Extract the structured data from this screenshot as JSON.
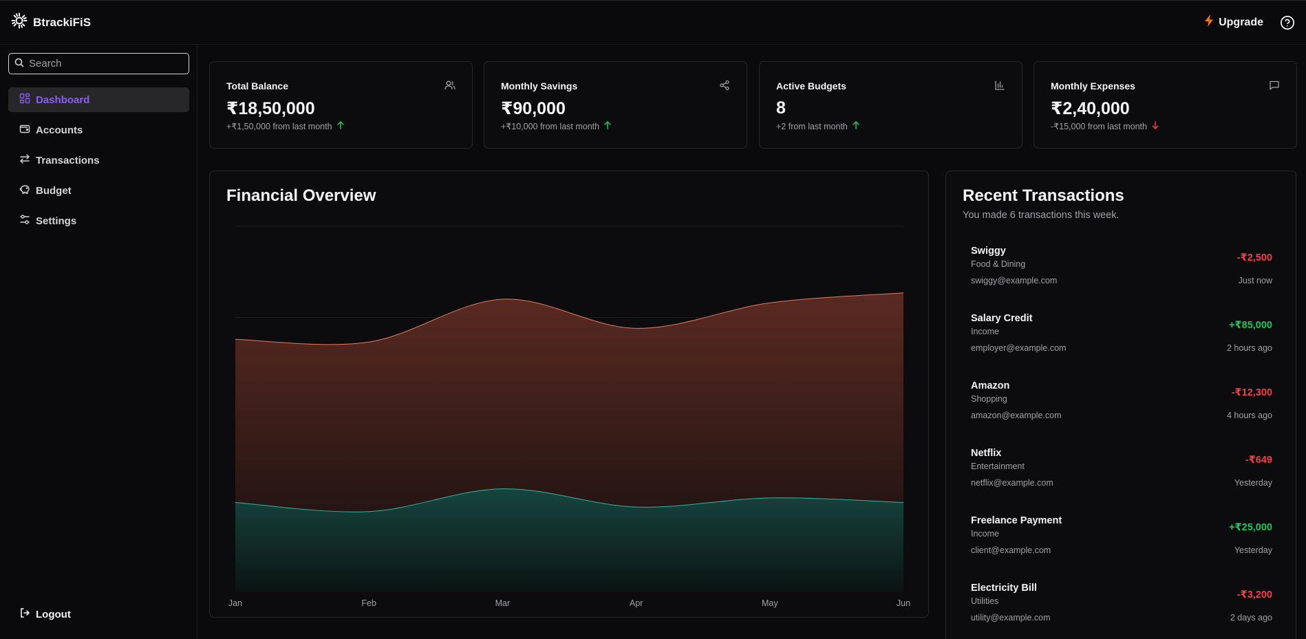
{
  "app": {
    "name": "BtrackiFiS"
  },
  "topbar": {
    "upgrade_label": "Upgrade",
    "upgrade_icon": "bolt-icon",
    "help_icon": "help-circle-icon"
  },
  "sidebar": {
    "search_placeholder": "Search",
    "items": [
      {
        "label": "Dashboard",
        "icon": "grid-icon",
        "active": true
      },
      {
        "label": "Accounts",
        "icon": "wallet-icon"
      },
      {
        "label": "Transactions",
        "icon": "arrows-swap-icon"
      },
      {
        "label": "Budget",
        "icon": "piggy-bank-icon"
      },
      {
        "label": "Settings",
        "icon": "sliders-icon"
      }
    ],
    "logout_label": "Logout"
  },
  "stats": [
    {
      "title": "Total Balance",
      "value": "₹18,50,000",
      "change": "+₹1,50,000 from last month",
      "trend": "up",
      "icon": "users-icon"
    },
    {
      "title": "Monthly Savings",
      "value": "₹90,000",
      "change": "+₹10,000 from last month",
      "trend": "up",
      "icon": "share-icon"
    },
    {
      "title": "Active Budgets",
      "value": "8",
      "change": "+2 from last month",
      "trend": "up",
      "icon": "bar-chart-icon"
    },
    {
      "title": "Monthly Expenses",
      "value": "₹2,40,000",
      "change": "-₹15,000 from last month",
      "trend": "down",
      "icon": "message-icon"
    }
  ],
  "overview": {
    "title": "Financial Overview"
  },
  "chart_data": {
    "type": "area",
    "title": "Financial Overview",
    "categories": [
      "Jan",
      "Feb",
      "Mar",
      "Apr",
      "May",
      "Jun"
    ],
    "ylim": [
      0,
      4
    ],
    "grid": true,
    "legend": "none",
    "series": [
      {
        "values": [
          2.76,
          2.73,
          3.2,
          2.88,
          3.16,
          3.27
        ],
        "color": "#e8785e"
      },
      {
        "values": [
          0.97,
          0.87,
          1.12,
          0.92,
          1.02,
          0.97
        ],
        "color": "#2bb5a0"
      }
    ]
  },
  "transactions": {
    "title": "Recent Transactions",
    "subtitle": "You made 6 transactions this week.",
    "items": [
      {
        "name": "Swiggy",
        "category": "Food & Dining",
        "email": "swiggy@example.com",
        "amount": "-₹2,500",
        "time": "Just now",
        "sign": "neg"
      },
      {
        "name": "Salary Credit",
        "category": "Income",
        "email": "employer@example.com",
        "amount": "+₹85,000",
        "time": "2 hours ago",
        "sign": "pos"
      },
      {
        "name": "Amazon",
        "category": "Shopping",
        "email": "amazon@example.com",
        "amount": "-₹12,300",
        "time": "4 hours ago",
        "sign": "neg"
      },
      {
        "name": "Netflix",
        "category": "Entertainment",
        "email": "netflix@example.com",
        "amount": "-₹649",
        "time": "Yesterday",
        "sign": "neg"
      },
      {
        "name": "Freelance Payment",
        "category": "Income",
        "email": "client@example.com",
        "amount": "+₹25,000",
        "time": "Yesterday",
        "sign": "pos"
      },
      {
        "name": "Electricity Bill",
        "category": "Utilities",
        "email": "utility@example.com",
        "amount": "-₹3,200",
        "time": "2 days ago",
        "sign": "neg"
      }
    ]
  },
  "colors": {
    "accent": "#8b5cf6",
    "positive": "#22c55e",
    "negative": "#ef4444",
    "upgrade": "#f97316"
  }
}
